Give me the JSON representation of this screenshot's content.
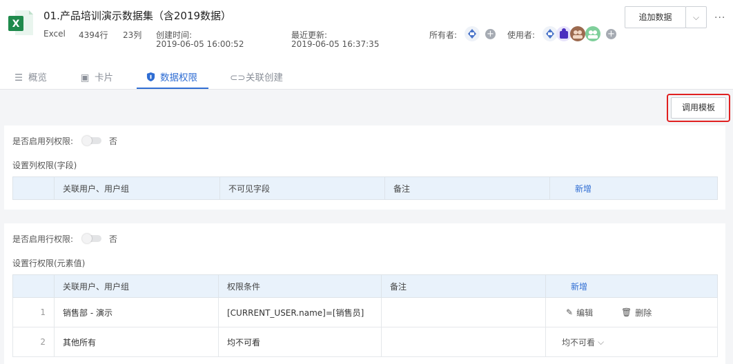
{
  "file": {
    "title": "01.产品培训演示数据集（含2019数据）",
    "type": "Excel",
    "rows": "4394行",
    "cols": "23列",
    "created_label": "创建时间:",
    "created_value": "2019-06-05 16:00:52",
    "updated_label": "最近更新:",
    "updated_value": "2019-06-05 16:37:35",
    "owner_label": "所有者:",
    "user_label": "使用者:"
  },
  "toolbar": {
    "append_label": "追加数据",
    "more_label": "···",
    "template_label": "调用模板"
  },
  "tabs": [
    {
      "label": "概览",
      "icon": "doc-icon"
    },
    {
      "label": "卡片",
      "icon": "image-icon"
    },
    {
      "label": "数据权限",
      "icon": "shield-icon",
      "active": true
    },
    {
      "label": "关联创建",
      "icon": "link-icon"
    }
  ],
  "column_permission": {
    "enable_label": "是否启用列权限:",
    "enable_value": "否",
    "section_title": "设置列权限(字段)",
    "headers": [
      "关联用户、用户组",
      "不可见字段",
      "备注",
      "新增"
    ]
  },
  "row_permission": {
    "enable_label": "是否启用行权限:",
    "enable_value": "否",
    "section_title": "设置行权限(元素值)",
    "headers": [
      "关联用户、用户组",
      "权限条件",
      "备注",
      "新增"
    ],
    "rows": [
      {
        "index": "1",
        "user": "销售部 - 演示",
        "condition": "[CURRENT_USER.name]=[销售员]",
        "note": "",
        "edit": "编辑",
        "delete": "删除"
      },
      {
        "index": "2",
        "user": "其他所有",
        "condition": "均不可看",
        "note": "",
        "select": "均不可看"
      }
    ]
  },
  "colors": {
    "accent": "#2f6dd3",
    "excel_green": "#1f8a4c",
    "highlight_red": "#e02020"
  }
}
